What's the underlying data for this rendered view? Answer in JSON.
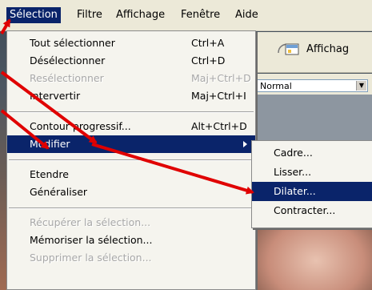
{
  "menubar": {
    "items": [
      "Sélection",
      "Filtre",
      "Affichage",
      "Fenêtre",
      "Aide"
    ]
  },
  "toolbar": {
    "label": "Affichag"
  },
  "options": {
    "blend_mode": "Normal"
  },
  "menu": {
    "items": [
      {
        "label": "Tout sélectionner",
        "shortcut": "Ctrl+A",
        "disabled": false
      },
      {
        "label": "Désélectionner",
        "shortcut": "Ctrl+D",
        "disabled": false
      },
      {
        "label": "Resélectionner",
        "shortcut": "Maj+Ctrl+D",
        "disabled": true
      },
      {
        "label": "Intervertir",
        "shortcut": "Maj+Ctrl+I",
        "disabled": false
      },
      {
        "label": "Contour progressif...",
        "shortcut": "Alt+Ctrl+D",
        "disabled": false
      },
      {
        "label": "Modifier",
        "shortcut": "",
        "disabled": false,
        "highlighted": true
      },
      {
        "label": "Etendre",
        "shortcut": "",
        "disabled": false
      },
      {
        "label": "Généraliser",
        "shortcut": "",
        "disabled": false
      },
      {
        "label": "Récupérer la sélection...",
        "shortcut": "",
        "disabled": true
      },
      {
        "label": "Mémoriser la sélection...",
        "shortcut": "",
        "disabled": false
      },
      {
        "label": "Supprimer la sélection...",
        "shortcut": "",
        "disabled": true
      }
    ]
  },
  "submenu": {
    "items": [
      {
        "label": "Cadre...",
        "highlighted": false
      },
      {
        "label": "Lisser...",
        "highlighted": false
      },
      {
        "label": "Dilater...",
        "highlighted": true
      },
      {
        "label": "Contracter...",
        "highlighted": false
      }
    ]
  },
  "colors": {
    "highlight": "#0a246a",
    "annotation_arrow": "#e00000",
    "menu_bg": "#f5f4ee"
  }
}
